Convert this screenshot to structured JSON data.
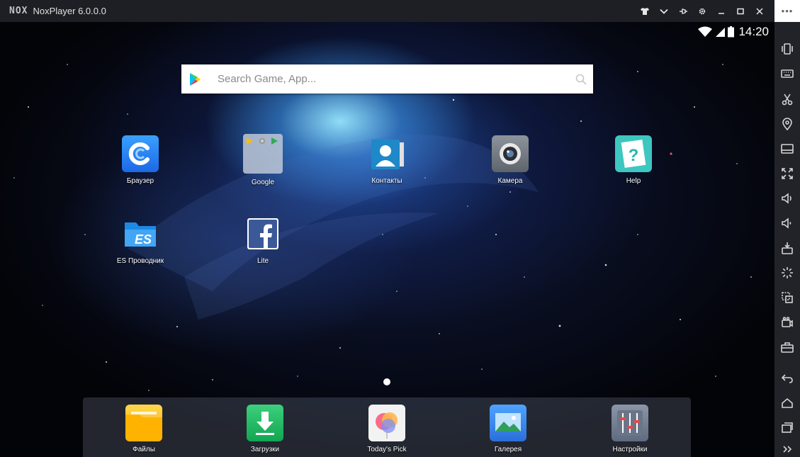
{
  "titlebar": {
    "logo": "NOX",
    "app_title": "NoxPlayer 6.0.0.0"
  },
  "statusbar": {
    "time": "14:20",
    "icons": [
      "wifi-icon",
      "signal-icon",
      "battery-icon"
    ]
  },
  "search": {
    "placeholder": "Search Game, App..."
  },
  "apps": [
    {
      "label": "Браузер",
      "icon": "browser-icon"
    },
    {
      "label": "Google",
      "icon": "google-folder-icon"
    },
    {
      "label": "Контакты",
      "icon": "contacts-icon"
    },
    {
      "label": "Камера",
      "icon": "camera-icon"
    },
    {
      "label": "Help",
      "icon": "help-icon"
    },
    {
      "label": "ES Проводник",
      "icon": "es-explorer-icon"
    },
    {
      "label": "Lite",
      "icon": "facebook-icon"
    }
  ],
  "dock": [
    {
      "label": "Файлы",
      "icon": "files-icon"
    },
    {
      "label": "Загрузки",
      "icon": "downloads-icon"
    },
    {
      "label": "Today's Pick",
      "icon": "todays-pick-icon"
    },
    {
      "label": "Галерея",
      "icon": "gallery-icon"
    },
    {
      "label": "Настройки",
      "icon": "settings-icon"
    }
  ],
  "right_toolbar": {
    "more_label": "•••",
    "items": [
      "shake-icon",
      "keyboard-icon",
      "scissors-icon",
      "location-icon",
      "screen-icon",
      "fullscreen-icon",
      "volume-up-icon",
      "volume-down-icon",
      "apk-icon",
      "loading-icon",
      "multi-instance-icon",
      "record-icon",
      "toolbox-icon",
      "back-icon",
      "home-icon",
      "recents-icon",
      "expand-icon"
    ]
  },
  "colors": {
    "titlebar_bg": "#1e1f24",
    "toolbar_bg": "#222329",
    "accent_blue": "#2f7ff0"
  }
}
